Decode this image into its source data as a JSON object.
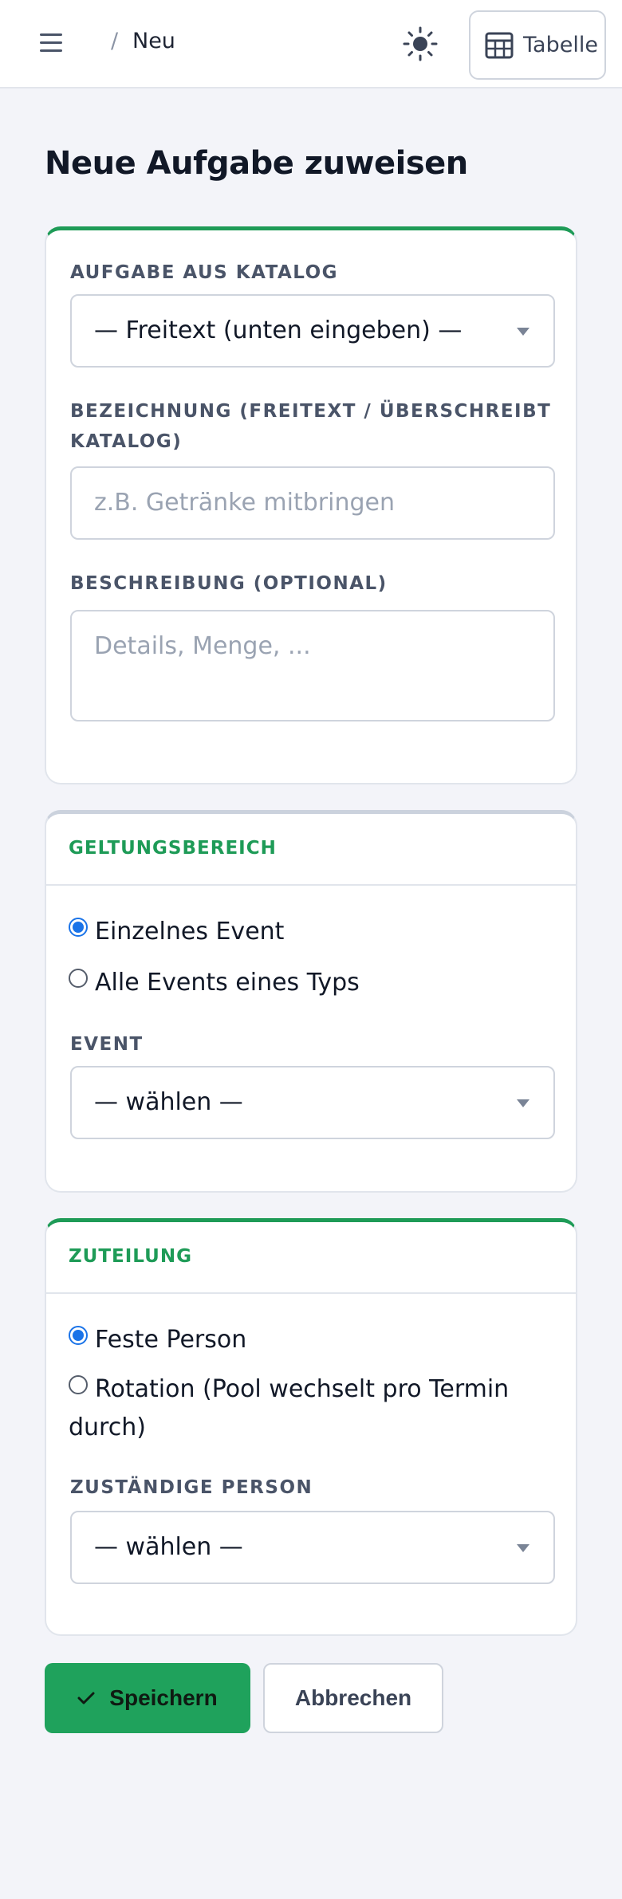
{
  "header": {
    "breadcrumb_separator": "/",
    "breadcrumb_current": "Neu",
    "table_button_label": "Tabelle",
    "menu_icon": "hamburger-icon",
    "theme_icon": "sun-icon",
    "table_icon": "table-icon"
  },
  "page": {
    "title": "Neue Aufgabe zuweisen"
  },
  "task_card": {
    "catalog_label": "AUFGABE AUS KATALOG",
    "catalog_value": "— Freitext (unten eingeben) —",
    "name_label_line1": "BEZEICHNUNG (FREITEXT / ÜBERSCHREIBT",
    "name_label_line2": "KATALOG)",
    "name_placeholder": "z.B. Getränke mitbringen",
    "description_label": "BESCHREIBUNG (OPTIONAL)",
    "description_placeholder": "Details, Menge, ..."
  },
  "scope_card": {
    "title": "GELTUNGSBEREICH",
    "options": [
      {
        "label": "Einzelnes Event",
        "selected": true
      },
      {
        "label": "Alle Events eines Typs",
        "selected": false
      }
    ],
    "event_label": "EVENT",
    "event_value": "— wählen —"
  },
  "assignment_card": {
    "title": "ZUTEILUNG",
    "options": [
      {
        "label": "Feste Person",
        "selected": true
      },
      {
        "label_line1": "Rotation (Pool wechselt pro Termin",
        "label_line2": "durch)",
        "selected": false
      }
    ],
    "person_label": "ZUSTÄNDIGE PERSON",
    "person_value": "— wählen —"
  },
  "actions": {
    "save_label": "Speichern",
    "save_icon": "check-icon",
    "cancel_label": "Abbrechen"
  },
  "colors": {
    "accent_green": "#1fa25c",
    "section_title_green": "#1e9b57",
    "radio_blue": "#1a73e8",
    "background": "#f3f4f9"
  }
}
